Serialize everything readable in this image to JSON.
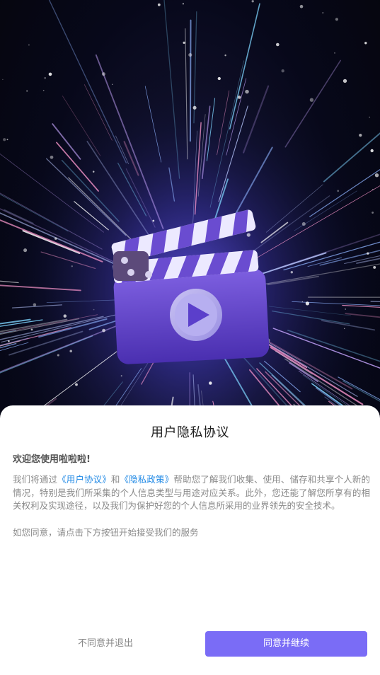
{
  "dialog": {
    "title": "用户隐私协议",
    "welcome": "欢迎您使用啦啦啦!",
    "body_prefix": "我们将通过",
    "user_agreement_link": "《用户协议》",
    "and_text": "和",
    "privacy_policy_link": "《隐私政策》",
    "body_suffix": "帮助您了解我们收集、使用、储存和共享个人新的情况，特别是我们所采集的个人信息类型与用途对应关系。此外，您还能了解您所享有的相关权利及实现途径，以及我们为保护好您的个人信息所采用的业界领先的安全技术。",
    "consent_text": "如您同意，请点击下方按钮开始接受我们的服务",
    "disagree_button": "不同意并退出",
    "agree_button": "同意并继续"
  },
  "colors": {
    "accent": "#7a6cf6",
    "link": "#1e88e5"
  },
  "icons": {
    "hero": "clapperboard-play-icon"
  }
}
